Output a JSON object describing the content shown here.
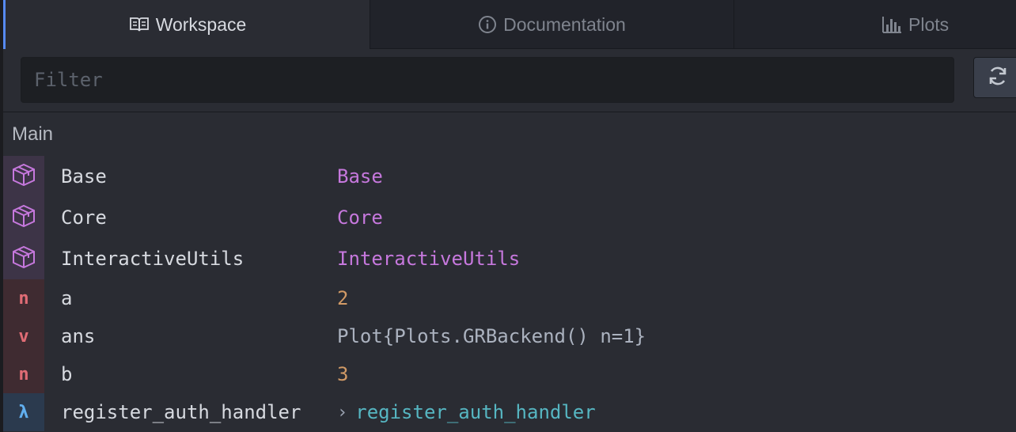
{
  "tabs": [
    {
      "label": "Workspace",
      "icon": "book-icon",
      "active": true
    },
    {
      "label": "Documentation",
      "icon": "info-icon",
      "active": false
    },
    {
      "label": "Plots",
      "icon": "bar-chart-icon",
      "active": false
    }
  ],
  "filter": {
    "placeholder": "Filter",
    "value": "",
    "refresh_icon": "refresh-icon"
  },
  "section": {
    "title": "Main"
  },
  "rows": [
    {
      "badge": "",
      "badge_icon": "package-icon",
      "name": "Base",
      "value": "Base"
    },
    {
      "badge": "",
      "badge_icon": "package-icon",
      "name": "Core",
      "value": "Core"
    },
    {
      "badge": "",
      "badge_icon": "package-icon",
      "name": "InteractiveUtils",
      "value": "InteractiveUtils"
    },
    {
      "badge": "n",
      "name": "a",
      "value": "2"
    },
    {
      "badge": "v",
      "name": "ans",
      "value": "Plot{Plots.GRBackend() n=1}"
    },
    {
      "badge": "n",
      "name": "b",
      "value": "3"
    },
    {
      "badge": "λ",
      "name": "register_auth_handler",
      "value": "register_auth_handler",
      "expand_icon": "chevron-right-icon"
    }
  ],
  "colors": {
    "module": "#c678dd",
    "number": "#d19a66",
    "function": "#56b6c2",
    "badge_red": "#e06c75",
    "badge_blue": "#61afef",
    "accent": "#568af2"
  }
}
